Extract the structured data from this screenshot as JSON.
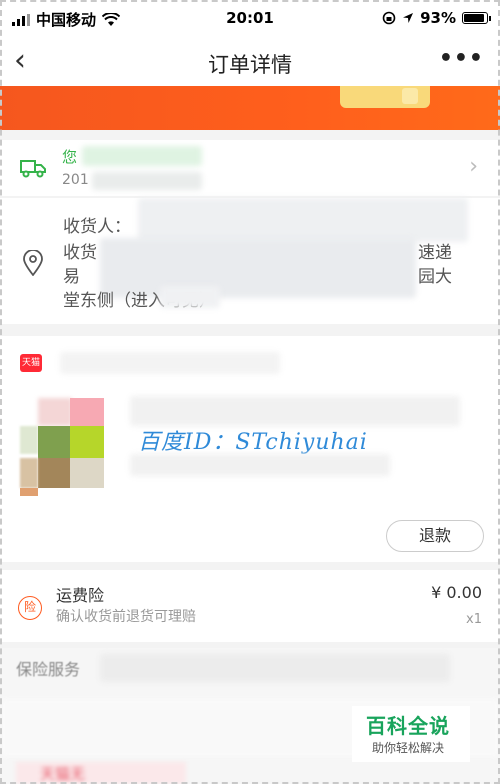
{
  "status_bar": {
    "carrier": "中国移动",
    "time": "20:01",
    "battery": "93%",
    "battery_level": 0.93,
    "icons": [
      "signal-icon",
      "wifi-icon",
      "rotation-lock-icon",
      "location-arrow-icon",
      "battery-icon"
    ]
  },
  "nav": {
    "back_icon": "‹",
    "title": "订单详情",
    "more_icon": "•••"
  },
  "logistics": {
    "status_text": "您",
    "date_text": "201",
    "icon": "truck-icon",
    "accent": "#35b34a"
  },
  "address": {
    "receiver_label": "收货人：",
    "line2_start": "收货",
    "line2_end": "速递",
    "line3_start": "易",
    "line3_end": "园大",
    "line4": "堂东侧（进入可见）",
    "icon": "location-pin-icon"
  },
  "product": {
    "shop_badge": "天猫",
    "watermark": "百度ID：STchiyuhai",
    "refund_label": "退款"
  },
  "insurance": {
    "badge": "险",
    "title": "运费险",
    "description": "确认收货前退货可理赔",
    "price": "¥ 0.00",
    "quantity": "x1",
    "accent": "#ff5a1f"
  },
  "service": {
    "label": "保险服务"
  },
  "baike": {
    "name": "百科全说",
    "slogan": "助你轻松解决"
  },
  "bottom": {
    "partial": "天猫无"
  },
  "colors": {
    "banner": "#ff5f1c",
    "background": "#f3f3f3"
  }
}
